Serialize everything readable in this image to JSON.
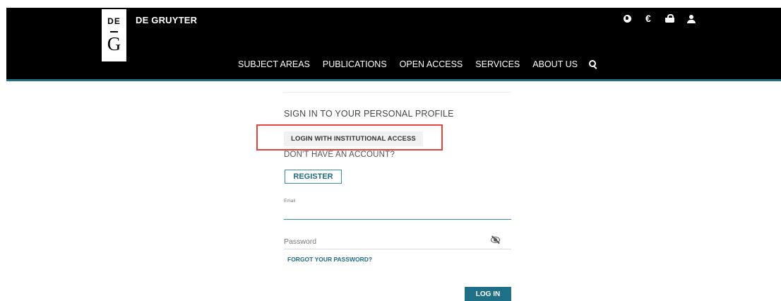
{
  "header": {
    "logo": {
      "top": "DE",
      "bottom": "G"
    },
    "brand": "DE GRUYTER",
    "icons": [
      "globe-icon",
      "euro-icon",
      "basket-icon",
      "user-icon"
    ],
    "euro_symbol": "€",
    "nav": [
      "SUBJECT AREAS",
      "PUBLICATIONS",
      "OPEN ACCESS",
      "SERVICES",
      "ABOUT US"
    ]
  },
  "login": {
    "title": "SIGN IN TO YOUR PERSONAL PROFILE",
    "institutional_button": "LOGIN WITH INSTITUTIONAL ACCESS",
    "no_account": "DON'T HAVE AN ACCOUNT?",
    "register_button": "REGISTER",
    "email_label": "Email",
    "email_value": "",
    "password_placeholder": "Password",
    "password_value": "",
    "forgot_link": "FORGOT YOUR PASSWORD?",
    "login_button": "LOG IN"
  },
  "colors": {
    "header_bg": "#000000",
    "accent": "#1f6f86",
    "highlight_border": "#e0453d"
  }
}
